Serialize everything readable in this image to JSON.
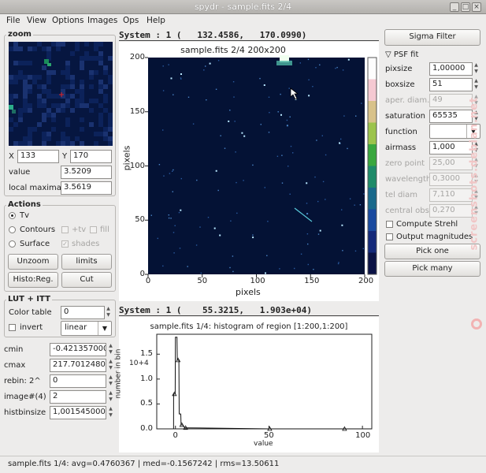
{
  "window": {
    "title": "spydr - sample.fits 2/4"
  },
  "menu": {
    "file": "File",
    "view": "View",
    "options": "Options",
    "images": "Images",
    "ops": "Ops",
    "help": "Help"
  },
  "zoom": {
    "title": "zoom",
    "x_label": "X",
    "x_value": "133",
    "y_label": "Y",
    "y_value": "170",
    "value_label": "value",
    "value_value": "3.5209",
    "local_maxima_label": "local maxima",
    "local_maxima_value": "3.5619"
  },
  "actions": {
    "title": "Actions",
    "tv": "Tv",
    "contours": "Contours",
    "plus_tv": "+tv",
    "fill": "fill",
    "surface": "Surface",
    "shades": "shades",
    "unzoom": "Unzoom",
    "limits": "limits",
    "histo_reg": "Histo:Reg.",
    "cut": "Cut"
  },
  "lut": {
    "title": "LUT + ITT",
    "color_table_label": "Color table",
    "color_table_value": "0",
    "invert": "invert",
    "itt_value": "linear"
  },
  "params": {
    "cmin_label": "cmin",
    "cmin_value": "-0.421357000(",
    "cmax_label": "cmax",
    "cmax_value": "217.70124800(",
    "rebin_label": "rebin: 2^",
    "rebin_value": "0",
    "image_label": "image#(4)",
    "image_value": "2",
    "histbinsize_label": "histbinsize",
    "histbinsize_value": "1,0015450000"
  },
  "image_view": {
    "readout": "System : 1 (   132.4586,   170.0990)",
    "title": "sample.fits 2/4 200x200",
    "xlabel": "pixels",
    "ylabel": "pixels",
    "xticks": [
      "0",
      "50",
      "100",
      "150",
      "200"
    ],
    "yticks": [
      "0",
      "50",
      "100",
      "150",
      "200"
    ]
  },
  "histogram": {
    "readout": "System : 1 (    55.3215,   1.903e+04)",
    "title": "sample.fits 1/4: histogram of region [1:200,1:200]",
    "xlabel": "value",
    "ylabel": "number in bin",
    "yexp": "10+4",
    "xticks": [
      "0",
      "50",
      "100"
    ],
    "yticks": [
      "0.0",
      "0.5",
      "1.0",
      "1.5"
    ]
  },
  "right": {
    "sigma_filter": "Sigma Filter",
    "psf_fit": "PSF fit",
    "pixsize_label": "pixsize",
    "pixsize_value": "1,00000",
    "boxsize_label": "boxsize",
    "boxsize_value": "51",
    "aper_label": "aper. diam.",
    "aper_value": "49",
    "saturation_label": "saturation",
    "saturation_value": "65535",
    "function_label": "function",
    "function_value": "",
    "airmass_label": "airmass",
    "airmass_value": "1,000",
    "zero_point_label": "zero point",
    "zero_point_value": "25,00",
    "wavelength_label": "wavelength",
    "wavelength_value": "0,3000",
    "tel_diam_label": "tel diam",
    "tel_diam_value": "7,110",
    "central_obs_label": "central obs",
    "central_obs_value": "0,270",
    "compute_strehl": "Compute Strehl",
    "output_magnitudes": "Output magnitudes",
    "pick_one": "Pick one",
    "pick_many": "Pick many"
  },
  "status": {
    "text": "sample.fits 1/4: avg=0.4760367 | med=-0.1567242 | rms=13.50611"
  },
  "watermark": "screenshots.debian.net",
  "chart_data": [
    {
      "type": "heatmap",
      "title": "sample.fits 2/4 200x200",
      "xlabel": "pixels",
      "ylabel": "pixels",
      "xlim": [
        0,
        200
      ],
      "ylim": [
        0,
        200
      ],
      "colorbar": "right"
    },
    {
      "type": "line",
      "title": "sample.fits 1/4: histogram of region [1:200,1:200]",
      "xlabel": "value",
      "ylabel": "number in bin",
      "xlim": [
        -10,
        105
      ],
      "ylim": [
        0,
        1.9
      ],
      "y_scale_label": "10+4",
      "x": [
        -1,
        0,
        1,
        2,
        3,
        5,
        50,
        90
      ],
      "y": [
        0.7,
        1.84,
        1.38,
        0.3,
        0.08,
        0.02,
        0.0,
        0.0
      ]
    }
  ]
}
